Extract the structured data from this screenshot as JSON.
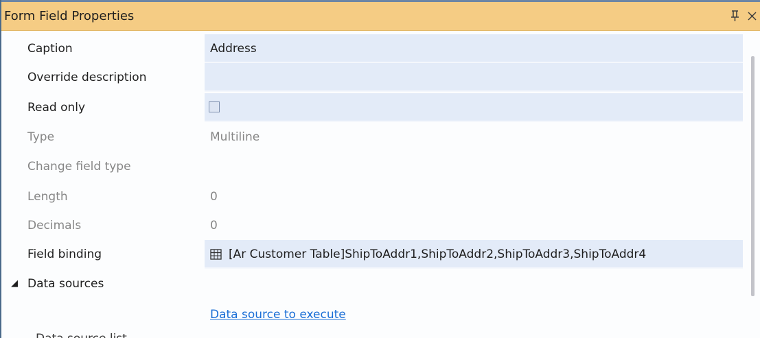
{
  "panel": {
    "title": "Form Field Properties",
    "pin_icon": "pin-icon",
    "close_icon": "close-icon"
  },
  "properties": {
    "caption": {
      "label": "Caption",
      "value": "Address"
    },
    "override_description": {
      "label": "Override description",
      "value": ""
    },
    "read_only": {
      "label": "Read only",
      "checked": false
    },
    "type": {
      "label": "Type",
      "value": "Multiline"
    },
    "change_field_type": {
      "label": "Change field type",
      "value": ""
    },
    "length": {
      "label": "Length",
      "value": "0"
    },
    "decimals": {
      "label": "Decimals",
      "value": "0"
    },
    "field_binding": {
      "label": "Field binding",
      "value": "[Ar Customer Table]ShipToAddr1,ShipToAddr2,ShipToAddr3,ShipToAddr4",
      "icon": "table-icon"
    }
  },
  "data_sources": {
    "label": "Data sources",
    "expander": "◢",
    "link": "Data source to execute"
  },
  "partial_row": {
    "label": "Data source list"
  },
  "colors": {
    "titlebar": "#f5cc84",
    "editable_cell": "#e3ebf8",
    "disabled_text": "#868686",
    "link": "#1a6ed6"
  }
}
